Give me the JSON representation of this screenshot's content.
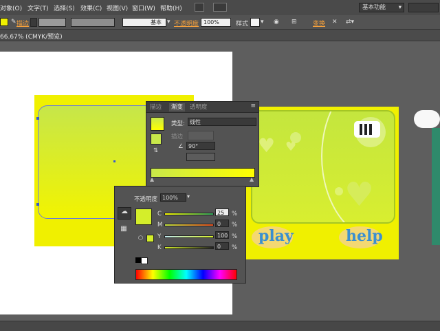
{
  "menu": {
    "items": [
      "对象(O)",
      "文字(T)",
      "选择(S)",
      "效果(C)",
      "视图(V)",
      "窗口(W)",
      "帮助(H)"
    ],
    "workspace": "基本功能"
  },
  "control_bar": {
    "stroke_label": "描边",
    "stroke_style": "基本",
    "opacity_label": "不透明度",
    "opacity_value": "100%",
    "style_label": "样式",
    "transform_label": "变换"
  },
  "document_tab": {
    "title": "66.67% (CMYK/预览)"
  },
  "artwork": {
    "play_label": "play",
    "help_label": "help"
  },
  "gradient_panel": {
    "tabs": [
      "描边",
      "渐变",
      "透明度"
    ],
    "active_tab": "渐变",
    "type_label": "类型:",
    "type_value": "线性",
    "stroke_label": "描边",
    "angle_value": "90°",
    "colors": {
      "start": "#c9e84a",
      "end": "#ffff00"
    }
  },
  "color_panel": {
    "opacity_label": "不透明度",
    "opacity_value": "100%",
    "channels": [
      {
        "label": "C",
        "value": "25",
        "unit": "%"
      },
      {
        "label": "M",
        "value": "0",
        "unit": "%"
      },
      {
        "label": "Y",
        "value": "100",
        "unit": "%"
      },
      {
        "label": "K",
        "value": "0",
        "unit": "%"
      }
    ],
    "fill_color": "#d4ee2a"
  }
}
